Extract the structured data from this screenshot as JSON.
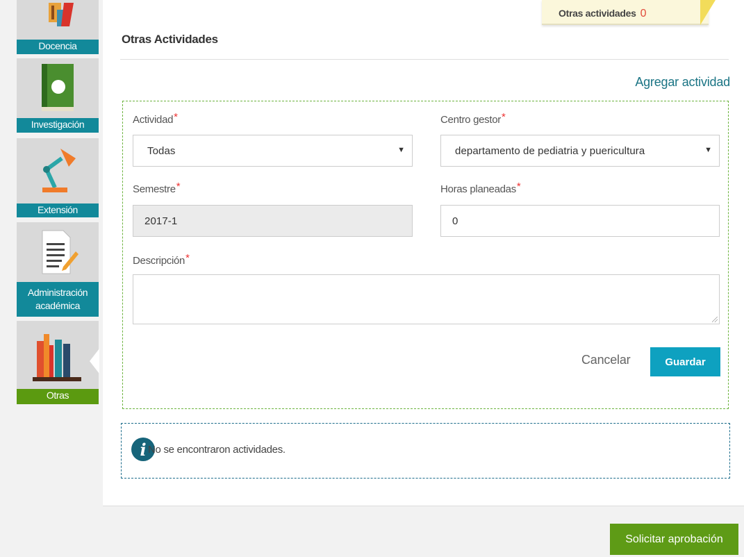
{
  "sidebar": {
    "items": [
      {
        "label": "Docencia"
      },
      {
        "label": "Investigación"
      },
      {
        "label": "Extensión"
      },
      {
        "label": "Administración académica"
      },
      {
        "label": "Otras"
      }
    ],
    "active_color": "#5b9a10",
    "item_color": "#12899a"
  },
  "header": {
    "title": "Otras Actividades",
    "tag_label": "Otras actividades",
    "tag_count": "0"
  },
  "form": {
    "add_link": "Agregar actividad",
    "actividad": {
      "label": "Actividad",
      "value": "Todas"
    },
    "centro_gestor": {
      "label": "Centro gestor",
      "value": "departamento de pediatria y puericultura"
    },
    "semestre": {
      "label": "Semestre",
      "value": "2017-1"
    },
    "horas": {
      "label": "Horas planeadas",
      "value": "0"
    },
    "descripcion": {
      "label": "Descripción",
      "value": ""
    },
    "required_mark": "*",
    "cancel_label": "Cancelar",
    "save_label": "Guardar"
  },
  "info": {
    "icon": "info-icon",
    "message": "No se encontraron actividades."
  },
  "footer": {
    "approve_label": "Solicitar aprobación"
  }
}
